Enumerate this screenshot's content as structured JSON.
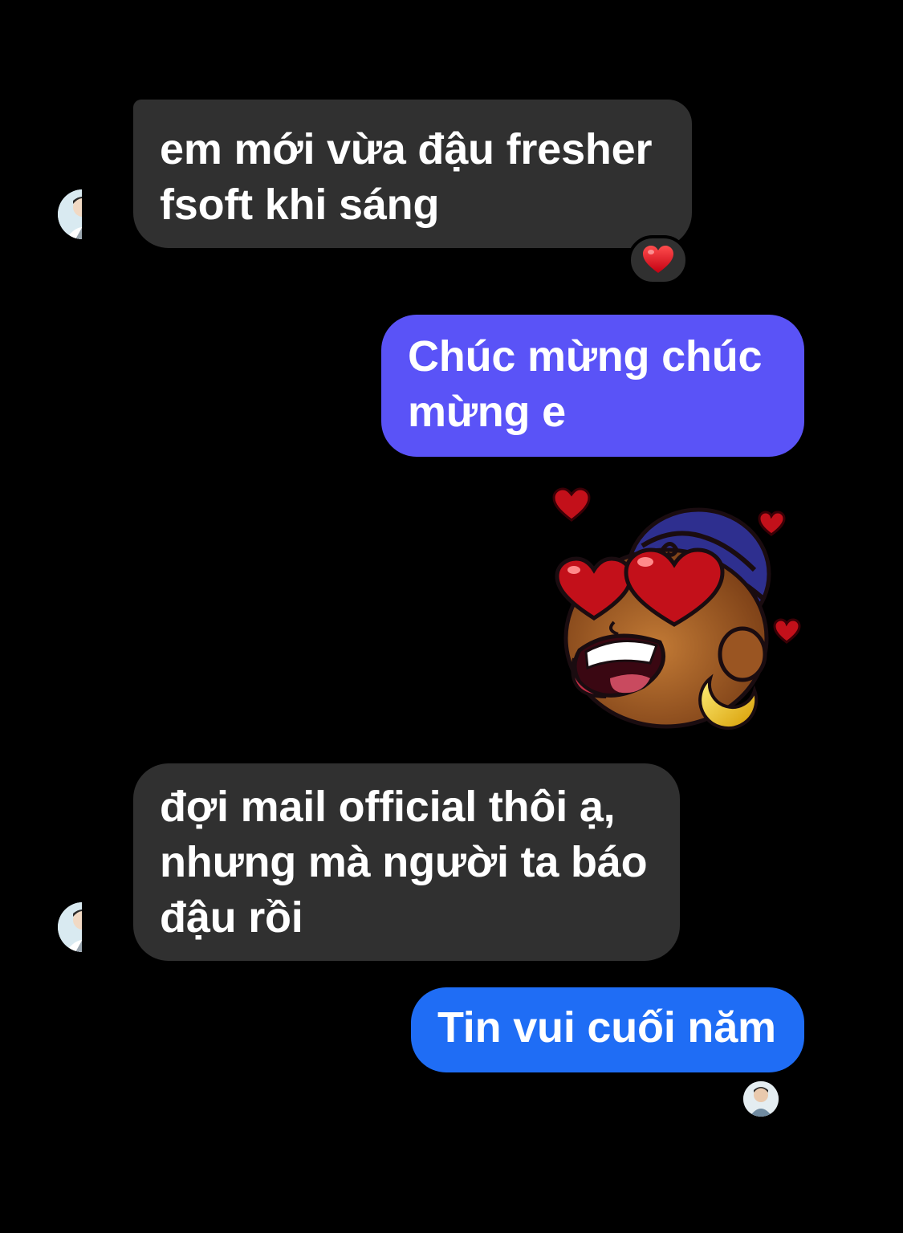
{
  "messages": [
    {
      "id": "msg1",
      "direction": "incoming",
      "text": "em mới vừa đậu fresher\nfsoft khi sáng",
      "reaction": "red-heart-icon"
    },
    {
      "id": "msg2",
      "direction": "outgoing",
      "text": "Chúc mừng chúc\nmừng e"
    },
    {
      "id": "msg3",
      "direction": "outgoing-sticker",
      "sticker": "heart-eyes-face-sticker"
    },
    {
      "id": "msg4",
      "direction": "incoming",
      "text": "đợi mail official thôi ạ,\nnhưng mà người ta báo\nđậu rồi"
    },
    {
      "id": "msg5",
      "direction": "outgoing",
      "text": "Tin vui cuối năm"
    }
  ],
  "colors": {
    "background": "#000000",
    "incoming_bubble": "#303030",
    "outgoing_bubble_purple": "#5a53f7",
    "outgoing_bubble_blue": "#1f6df5",
    "text": "#ffffff"
  },
  "icons": {
    "reaction": "red-heart-icon",
    "contact_avatar": "contact-avatar",
    "seen_indicator": "seen-avatar"
  }
}
